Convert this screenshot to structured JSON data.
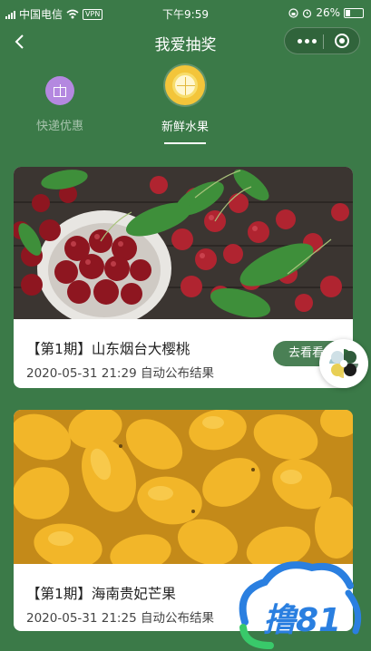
{
  "status_bar": {
    "carrier": "中国电信",
    "vpn": "VPN",
    "time": "下午9:59",
    "battery": "26%",
    "battery_level_percent": 26
  },
  "nav": {
    "title": "我爱抽奖"
  },
  "tabs": [
    {
      "label": "快递优惠",
      "icon": "gift-icon",
      "active": false
    },
    {
      "label": "新鲜水果",
      "icon": "lemon-icon",
      "active": true
    }
  ],
  "cards": [
    {
      "title": "【第1期】山东烟台大樱桃",
      "date": "2020-05-31 21:29 自动公布结果",
      "button": "去看看",
      "image": "cherries-photo"
    },
    {
      "title": "【第1期】海南贵妃芒果",
      "date": "2020-05-31 21:25 自动公布结果",
      "image": "mangoes-photo"
    }
  ],
  "watermark": "撸81",
  "colors": {
    "background": "#3b7a48",
    "button": "#4a8055",
    "accent_yellow": "#f3c53a",
    "gift_purple": "#b488e0",
    "watermark_blue": "#2a7fe0"
  }
}
